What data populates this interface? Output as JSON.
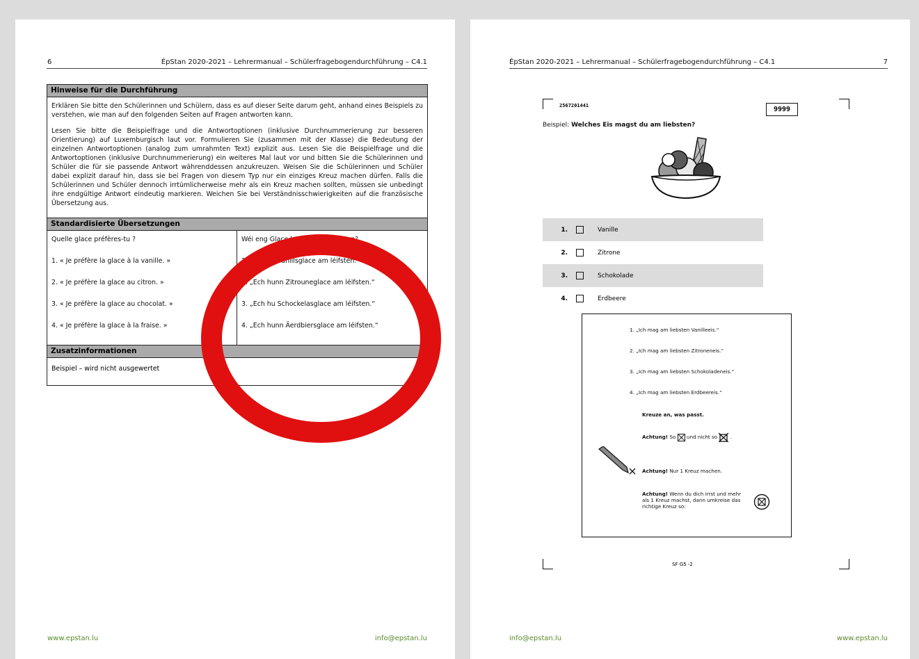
{
  "left_page": {
    "page_number": "6",
    "header": "ÉpStan 2020-2021 – Lehrermanual – Schülerfragebogendurchführung – C4.1",
    "hints_heading": "Hinweise für die Durchführung",
    "hints_para1": "Erklären Sie bitte den Schülerinnen und Schülern, dass es auf dieser Seite darum geht, anhand eines Beispiels zu verstehen, wie man auf den folgenden Seiten auf Fragen antworten kann.",
    "hints_para2": "Lesen Sie bitte die Beispielfrage und die Antwortoptionen (inklusive Durchnummerierung zur besseren Orientierung) auf Luxemburgisch laut vor. Formulieren Sie (zusammen mit der Klasse) die Bedeutung der einzelnen Antwortoptionen (analog zum umrahmten Text) explizit aus. Lesen Sie die Beispielfrage und die Antwortoptionen (inklusive Durchnummerierung) ein weiteres Mal laut vor und bitten Sie die Schülerinnen und Schüler die für sie passende Antwort währenddessen anzukreuzen. Weisen Sie die Schülerinnen und Schüler dabei explizit darauf hin, dass sie bei Fragen von diesem Typ nur ein einziges Kreuz machen dürfen. Falls die Schülerinnen und Schüler dennoch irrtümlicherweise mehr als ein Kreuz machen sollten, müssen sie unbedingt ihre endgültige Antwort eindeutig markieren. Weichen Sie bei Verständnisschwierigkeiten auf die französische Übersetzung aus.",
    "translations_heading": "Standardisierte Übersetzungen",
    "french_column": [
      "Quelle glace préfères-tu ?",
      "1. « Je préfère la glace à la vanille. »",
      "2. « Je préfère la glace au citron. »",
      "3. « Je préfère la glace au chocolat. »",
      "4. « Je préfère la glace à la fraise. »"
    ],
    "lux_column": [
      "Wéi eng Glace hues du am léifsten?",
      "1. „Ech hu Vanillsglace am léifsten.“",
      "2. „Ech hunn Zitrouneglace am léifsten.“",
      "3. „Ech hu Schockelasglace am léifsten.“",
      "4. „Ech hunn Äerdbiersglace am léifsten.“"
    ],
    "extra_heading": "Zusatzinformationen",
    "extra_text": "Beispiel – wird nicht ausgewertet",
    "footer_left": "www.epstan.lu",
    "footer_right": "info@epstan.lu"
  },
  "right_page": {
    "header": "ÉpStan 2020-2021 – Lehrermanual – Schülerfragebogendurchführung – C4.1",
    "page_number": "7",
    "barcode_number": "2567201441",
    "id_box": "9999",
    "question_prefix": "Beispiel:",
    "question": "Welches Eis magst du am liebsten?",
    "options": [
      {
        "num": "1.",
        "label": "Vanille"
      },
      {
        "num": "2.",
        "label": "Zitrone"
      },
      {
        "num": "3.",
        "label": "Schokolade"
      },
      {
        "num": "4.",
        "label": "Erdbeere"
      }
    ],
    "box_quotes": [
      "1.   „Ich mag am liebsten Vanilleeis.“",
      "2.   „Ich mag am liebsten Zitroneneis.“",
      "3.   „Ich mag am liebsten Schokoladeneis.“",
      "4.   „Ich mag am liebsten Erdbeereis.“"
    ],
    "instruction1": "Kreuze an, was passt.",
    "attention": "Achtung!",
    "instr2_a": "So",
    "instr2_b": "und nicht so",
    "instr3": "Nur 1 Kreuz machen.",
    "instr4": "Wenn du dich irrst und mehr als 1 Kreuz machst, dann umkreise das richtige Kreuz so:",
    "form_code": "SF G5 -2",
    "footer_left": "info@epstan.lu",
    "footer_right": "www.epstan.lu"
  }
}
